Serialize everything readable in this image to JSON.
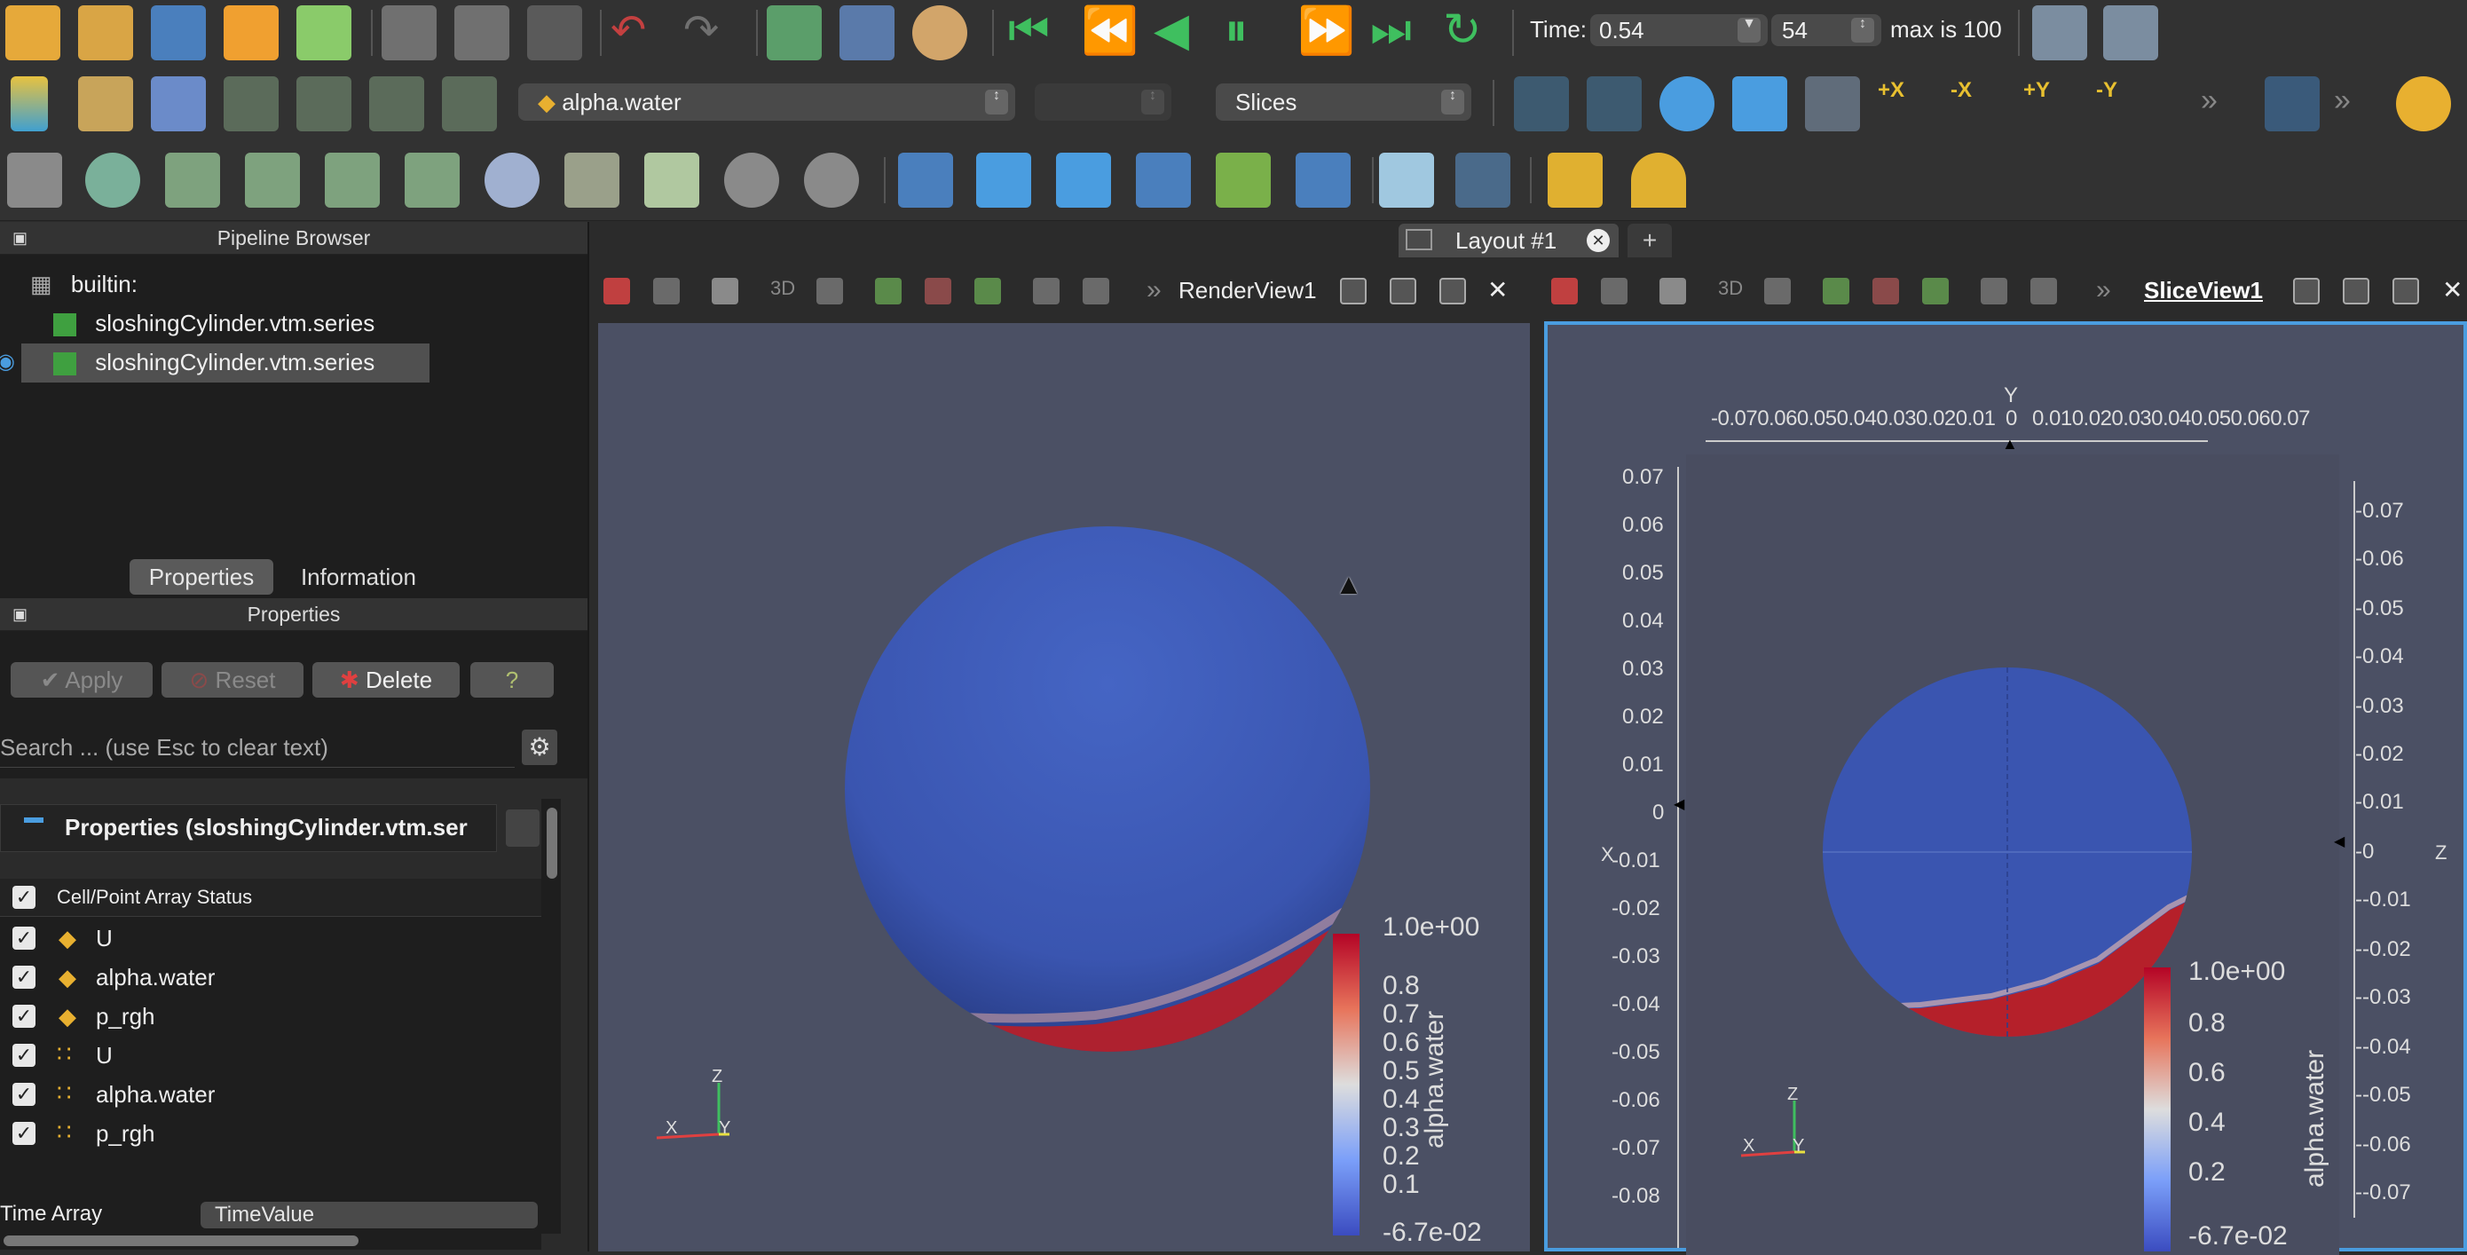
{
  "toolbar_top": {
    "time_label": "Time:",
    "time_value": "0.54",
    "timestep_value": "54",
    "max_label": "max is 100",
    "colors": {
      "green": "#3fbf5f",
      "red": "#c44040",
      "blue": "#4a9de0",
      "orange": "#e8a640"
    }
  },
  "toolbar_second": {
    "array_select": "alpha.water",
    "component_select": "",
    "representation_select": "Slices",
    "camera_labels": [
      "+X",
      "-X",
      "+Y",
      "-Y"
    ]
  },
  "pipeline": {
    "title": "Pipeline Browser",
    "root": "builtin:",
    "items": [
      "sloshingCylinder.vtm.series",
      "sloshingCylinder.vtm.series"
    ]
  },
  "tabs": {
    "properties": "Properties",
    "information": "Information"
  },
  "properties_panel": {
    "title": "Properties",
    "apply": "Apply",
    "reset": "Reset",
    "delete": "Delete",
    "help": "?",
    "search_placeholder": "Search ... (use Esc to clear text)",
    "section_title": "Properties (sloshingCylinder.vtm.ser",
    "array_status_header": "Cell/Point Array Status",
    "arrays": [
      "U",
      "alpha.water",
      "p_rgh",
      "U",
      "alpha.water",
      "p_rgh"
    ],
    "time_array_label": "Time Array",
    "time_array_value": "TimeValue"
  },
  "layout_tab": {
    "label": "Layout #1",
    "add": "+"
  },
  "render_view": {
    "label": "RenderView1",
    "btn_3d": "3D",
    "colorbar_title": "alpha.water",
    "colorbar_ticks": [
      "1.0e+00",
      "0.8",
      "0.7",
      "0.6",
      "0.5",
      "0.4",
      "0.3",
      "0.2",
      "0.1",
      "-6.7e-02"
    ],
    "axes": {
      "x": "X",
      "y": "Y",
      "z": "Z"
    }
  },
  "slice_view": {
    "label": "SliceView1",
    "btn_3d": "3D",
    "top_axis_y_label": "Y",
    "top_ticks_left": "-0.070.060.050.040.030.020.01",
    "top_tick_zero": "0",
    "top_ticks_right": "0.010.020.030.040.050.060.07",
    "left_axis_label": "X",
    "left_ticks": [
      "0.07",
      "0.06",
      "0.05",
      "0.04",
      "0.03",
      "0.02",
      "0.01",
      "0",
      "-0.01",
      "-0.02",
      "-0.03",
      "-0.04",
      "-0.05",
      "-0.06",
      "-0.07",
      "-0.08"
    ],
    "right_axis_label": "Z",
    "right_ticks": [
      "-0.07",
      "-0.06",
      "-0.05",
      "-0.04",
      "-0.03",
      "-0.02",
      "-0.01",
      "-0",
      "--0.01",
      "--0.02",
      "--0.03",
      "--0.04",
      "--0.05",
      "--0.06",
      "--0.07"
    ],
    "colorbar_title": "alpha.water",
    "colorbar_ticks": [
      "1.0e+00",
      "0.8",
      "0.6",
      "0.4",
      "0.2",
      "-6.7e-02"
    ],
    "axes": {
      "x": "X",
      "y": "Y",
      "z": "Z"
    }
  }
}
